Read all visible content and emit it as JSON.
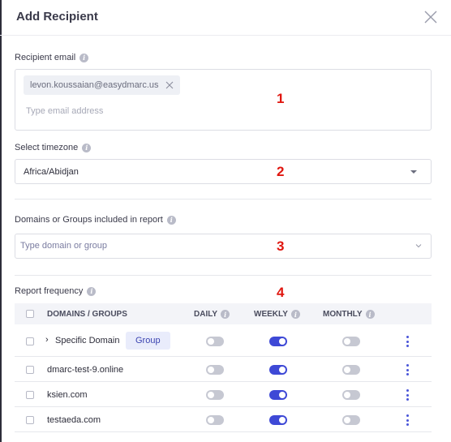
{
  "modal": {
    "title": "Add Recipient"
  },
  "recipient_email": {
    "label": "Recipient email",
    "chips": [
      "levon.koussaian@easydmarc.us"
    ],
    "placeholder": "Type email address",
    "value": ""
  },
  "timezone": {
    "label": "Select timezone",
    "selected": "Africa/Abidjan"
  },
  "domains": {
    "label": "Domains or Groups included in report",
    "placeholder": "Type domain or group"
  },
  "report_frequency": {
    "label": "Report frequency",
    "columns": [
      "DOMAINS / GROUPS",
      "DAILY",
      "WEEKLY",
      "MONTHLY"
    ],
    "rows": [
      {
        "name": "Specific Domain",
        "badge": "Group",
        "expandable": true,
        "daily": false,
        "weekly": true,
        "monthly": false
      },
      {
        "name": "dmarc-test-9.online",
        "badge": "",
        "expandable": false,
        "daily": false,
        "weekly": true,
        "monthly": false
      },
      {
        "name": "ksien.com",
        "badge": "",
        "expandable": false,
        "daily": false,
        "weekly": true,
        "monthly": false
      },
      {
        "name": "testaeda.com",
        "badge": "",
        "expandable": false,
        "daily": false,
        "weekly": true,
        "monthly": false
      }
    ]
  },
  "annotations": [
    "1",
    "2",
    "3",
    "4"
  ],
  "colors": {
    "accent": "#3e49d6",
    "toggle_off": "#c6c8d2",
    "annotation": "#e0160f",
    "badge_bg": "#e9ecfb"
  }
}
